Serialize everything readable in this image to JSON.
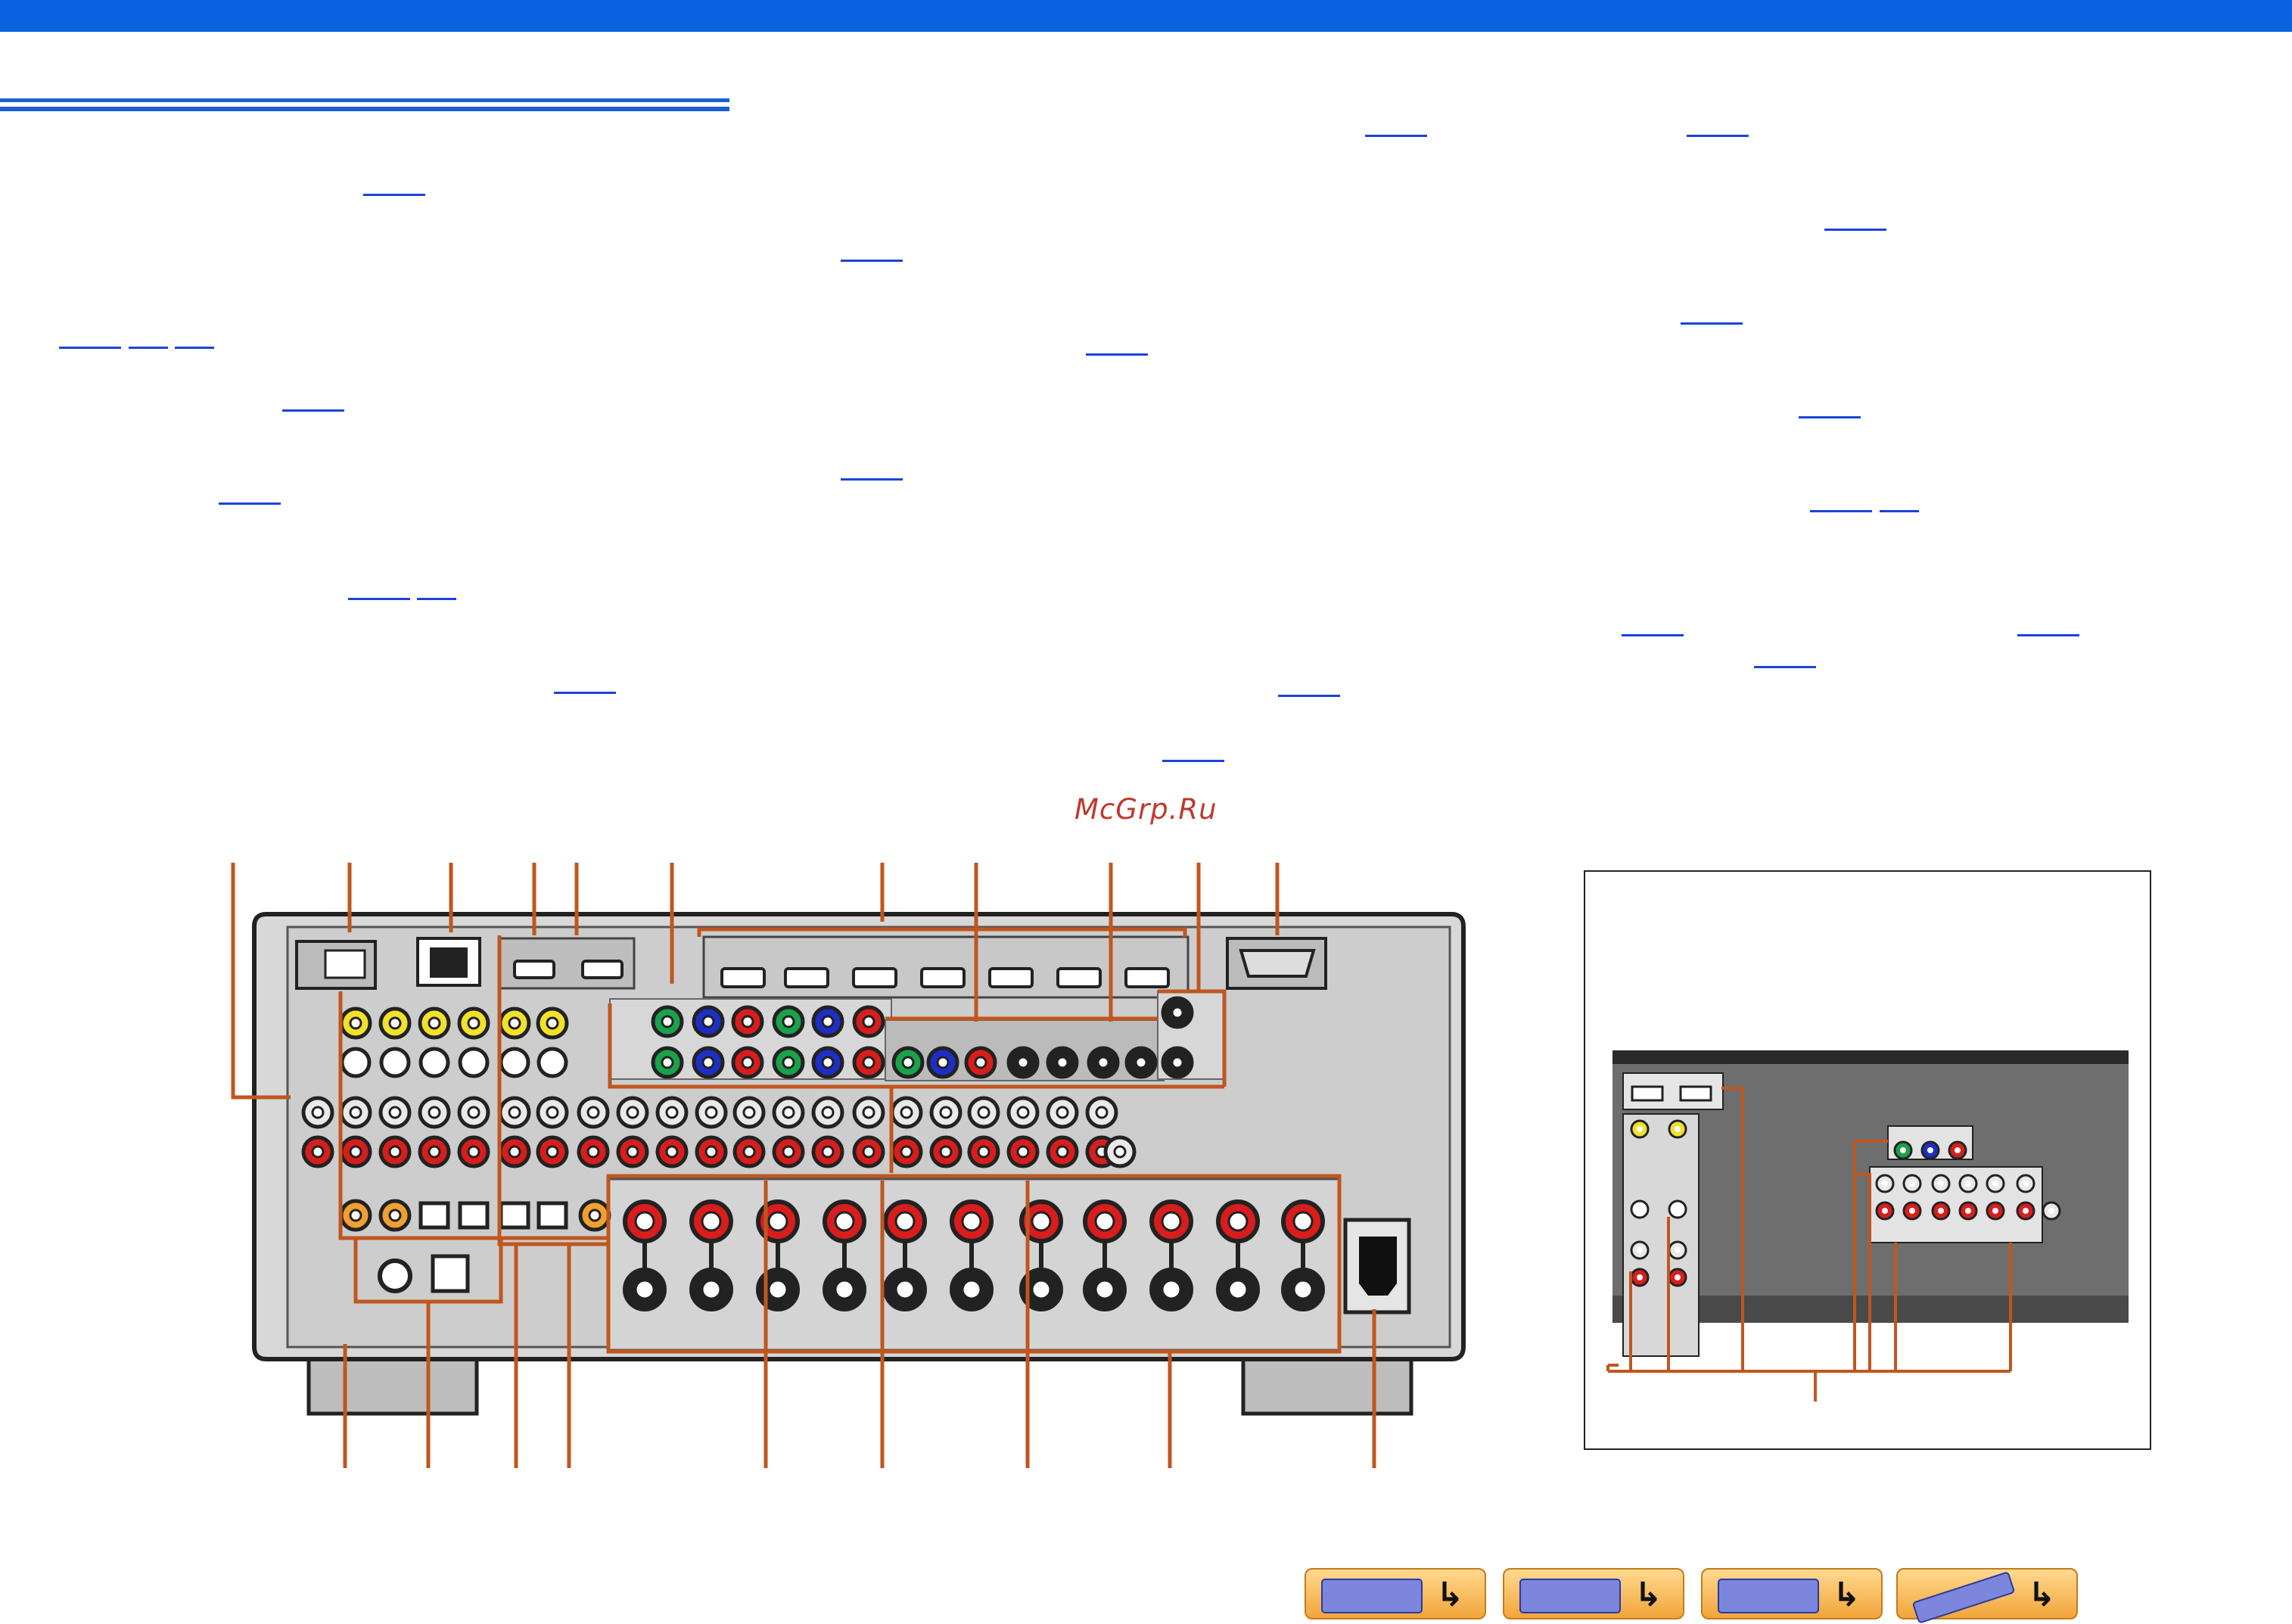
{
  "watermark": "McGrp.Ru",
  "colors": {
    "header": "#0a62e0",
    "callout": "#c0561f",
    "panel": "#cfcfcf",
    "chassis": "#222222",
    "jack_red": "#d91d1d",
    "jack_yellow": "#f2e12a",
    "jack_green": "#19a24a",
    "jack_blue": "#1d2ec9",
    "jack_white": "#e9e9e9"
  },
  "nav": [
    {
      "icon": "front-panel-icon"
    },
    {
      "icon": "rear-panel-icon"
    },
    {
      "icon": "display-icon"
    },
    {
      "icon": "remote-control-icon"
    }
  ]
}
